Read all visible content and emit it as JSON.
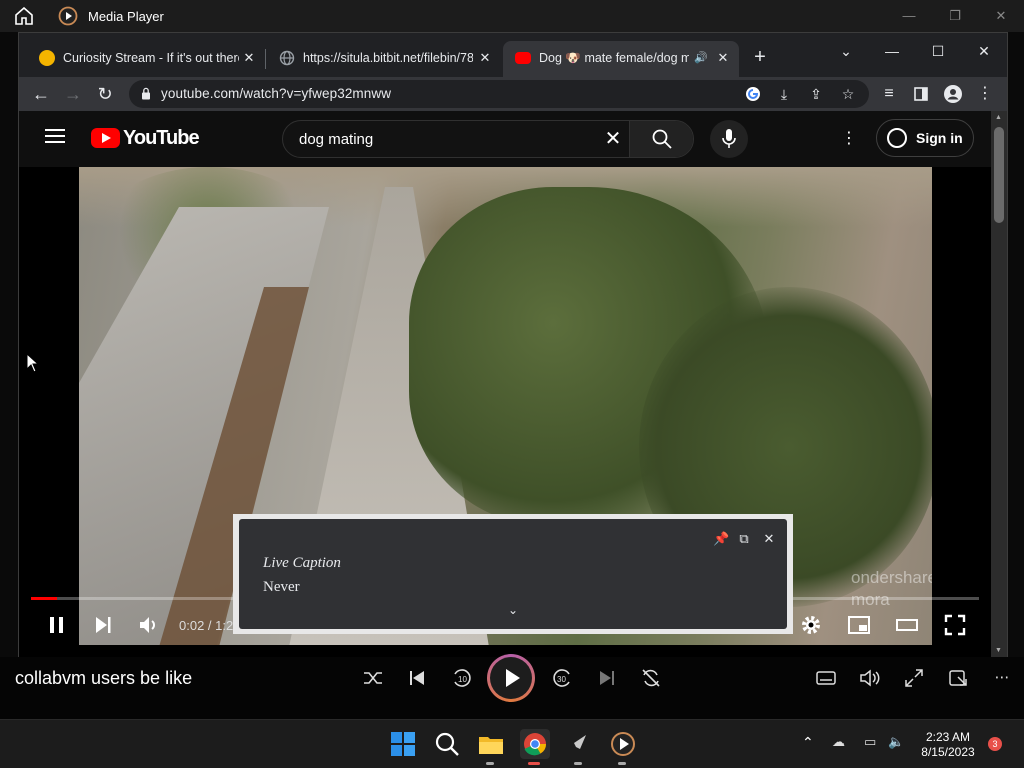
{
  "media_player": {
    "title": "Media Player",
    "song_title": "collabvm users be like",
    "controls": [
      "shuffle",
      "previous",
      "skip-back-10",
      "play",
      "skip-forward-30",
      "next",
      "repeat"
    ],
    "right_controls": [
      "miniplayer",
      "volume",
      "fullscreen",
      "compact",
      "more"
    ]
  },
  "browser": {
    "tabs": [
      {
        "label": "Curiosity Stream - If it's out there",
        "favicon_color": "#f4b400"
      },
      {
        "label": "https://situla.bitbit.net/filebin/78",
        "favicon_color": "#9aa0a6"
      },
      {
        "label": "Dog 🐶 mate female/dog m",
        "favicon_color": "#ff0000",
        "active": true
      }
    ],
    "url": "youtube.com/watch?v=yfwep32mnww"
  },
  "youtube": {
    "logo_text": "YouTube",
    "search_query": "dog mating",
    "sign_in_label": "Sign in"
  },
  "player": {
    "time": "0:02 / 1:2",
    "progress_fraction": 0.027,
    "watermark_line1": "ondershare",
    "watermark_line2": "mora"
  },
  "live_caption": {
    "title": "Live Caption",
    "text": "Never"
  },
  "taskbar": {
    "time": "2:23 AM",
    "date": "8/15/2023",
    "notification_count": "3"
  },
  "colors": {
    "youtube_red": "#ff0000",
    "accent_gradient_start": "#b65fa9",
    "accent_gradient_end": "#e07a3f"
  }
}
